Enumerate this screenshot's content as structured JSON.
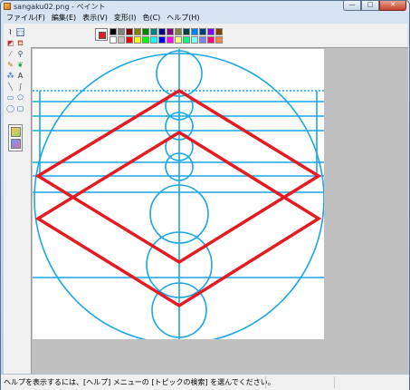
{
  "window": {
    "title": "sangaku02.png - ペイント",
    "buttons": {
      "minimize": "—",
      "maximize": "□",
      "close": "✕"
    }
  },
  "menu": [
    "ファイル(F)",
    "編集(E)",
    "表示(V)",
    "変形(I)",
    "色(C)",
    "ヘルプ(H)"
  ],
  "tools": [
    {
      "name": "free-select",
      "icon": "free-select-icon",
      "glyph": "⌇"
    },
    {
      "name": "rect-select",
      "icon": "rect-select-icon",
      "glyph": "⬚"
    },
    {
      "name": "eraser",
      "icon": "eraser-icon",
      "glyph": "◩"
    },
    {
      "name": "fill",
      "icon": "fill-bucket-icon",
      "glyph": "⛾"
    },
    {
      "name": "color-picker",
      "icon": "eyedropper-icon",
      "glyph": "⁄"
    },
    {
      "name": "magnifier",
      "icon": "magnifier-icon",
      "glyph": "⚲"
    },
    {
      "name": "pencil",
      "icon": "pencil-icon",
      "glyph": "✎"
    },
    {
      "name": "brush",
      "icon": "brush-icon",
      "glyph": "❦"
    },
    {
      "name": "airbrush",
      "icon": "airbrush-icon",
      "glyph": "⁂"
    },
    {
      "name": "text",
      "icon": "text-icon",
      "glyph": "A"
    },
    {
      "name": "line",
      "icon": "line-icon",
      "glyph": "╲"
    },
    {
      "name": "curve",
      "icon": "curve-icon",
      "glyph": "∫"
    },
    {
      "name": "rectangle",
      "icon": "rectangle-icon",
      "glyph": "▭"
    },
    {
      "name": "polygon",
      "icon": "polygon-icon",
      "glyph": "⬠"
    },
    {
      "name": "ellipse",
      "icon": "ellipse-icon",
      "glyph": "◯"
    },
    {
      "name": "rounded-rect",
      "icon": "rounded-rectangle-icon",
      "glyph": "▢"
    }
  ],
  "palette": {
    "foreground": "#e02020",
    "colors": [
      "#000000",
      "#808080",
      "#800000",
      "#808000",
      "#008000",
      "#008080",
      "#000080",
      "#800080",
      "#808040",
      "#004040",
      "#0080ff",
      "#004080",
      "#8000ff",
      "#804000",
      "#ffffff",
      "#c0c0c0",
      "#ff0000",
      "#ffff00",
      "#00ff00",
      "#00ffff",
      "#0000ff",
      "#ff00ff",
      "#ffff80",
      "#00ff80",
      "#80ffff",
      "#8080ff",
      "#ff0080",
      "#ff8040"
    ]
  },
  "drawing": {
    "circle_color": "#1aa6e6",
    "diamond_color": "#e31b23"
  },
  "status": {
    "text": "ヘルプを表示するには、[ヘルプ] メニューの [トピックの検索] を選んでください。"
  }
}
